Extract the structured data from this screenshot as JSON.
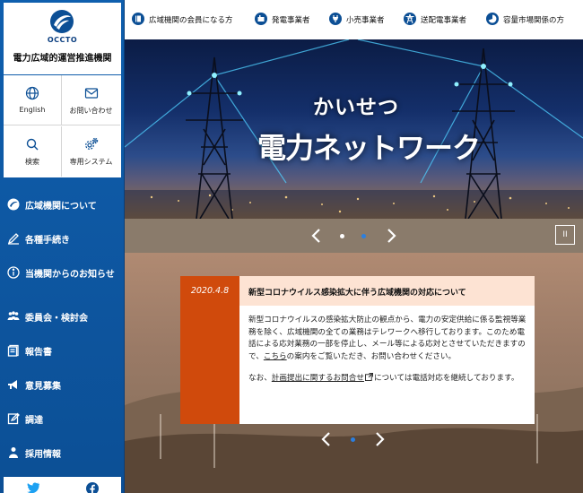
{
  "logo": {
    "text": "OCCTO",
    "org_name": "電力広域的運営推進機関"
  },
  "quick_links": [
    {
      "label": "English",
      "icon": "globe-icon"
    },
    {
      "label": "お問い合わせ",
      "icon": "mail-icon"
    },
    {
      "label": "検索",
      "icon": "search-icon"
    },
    {
      "label": "専用システム",
      "icon": "gear-icon"
    }
  ],
  "sidebar": {
    "items": [
      {
        "label": "広域機関について",
        "icon": "logo-mark-icon"
      },
      {
        "label": "各種手続き",
        "icon": "pen-icon"
      },
      {
        "label": "当機関からのお知らせ",
        "icon": "info-icon"
      },
      {
        "label": "委員会・検討会",
        "icon": "people-icon"
      },
      {
        "label": "報告書",
        "icon": "document-icon"
      },
      {
        "label": "意見募集",
        "icon": "speaker-icon"
      },
      {
        "label": "調達",
        "icon": "edit-icon"
      },
      {
        "label": "採用情報",
        "icon": "person-icon"
      }
    ]
  },
  "social": {
    "twitter_icon": "twitter-icon",
    "facebook_icon": "facebook-icon"
  },
  "topnav": {
    "links": [
      {
        "label": "広域機関の会員になる方",
        "icon": "book-icon"
      },
      {
        "label": "発電事業者",
        "icon": "building-icon"
      },
      {
        "label": "小売事業者",
        "icon": "plug-icon"
      },
      {
        "label": "送配電事業者",
        "icon": "tower-icon"
      },
      {
        "label": "容量市場関係の方",
        "icon": "chart-icon"
      }
    ]
  },
  "hero": {
    "title_line1": "かいせつ",
    "title_line2": "電力ネットワーク"
  },
  "slider": {
    "pause_label": "II"
  },
  "news": {
    "date": "2020.4.8",
    "title": "新型コロナウイルス感染拡大に伴う広域機関の対応について",
    "para1_before": "新型コロナウイルスの感染拡大防止の観点から、電力の安定供給に係る監視等業務を除く、広域機関の全ての業務はテレワークへ移行しております。このため電話による応対業務の一部を停止し、メール等による応対とさせていただきますので、",
    "para1_link": "こちら",
    "para1_after": "の案内をご覧いただき、お問い合わせください。",
    "para2_before": "なお、",
    "para2_link": "計画提出に関するお問合せ",
    "para2_after": "については電話対応を継続しております。"
  },
  "colors": {
    "sidebar": "#0f5fae",
    "accent_orange": "#d04a0c",
    "news_head_bg": "#fde3d3",
    "dot_active": "#2b7fe0"
  }
}
